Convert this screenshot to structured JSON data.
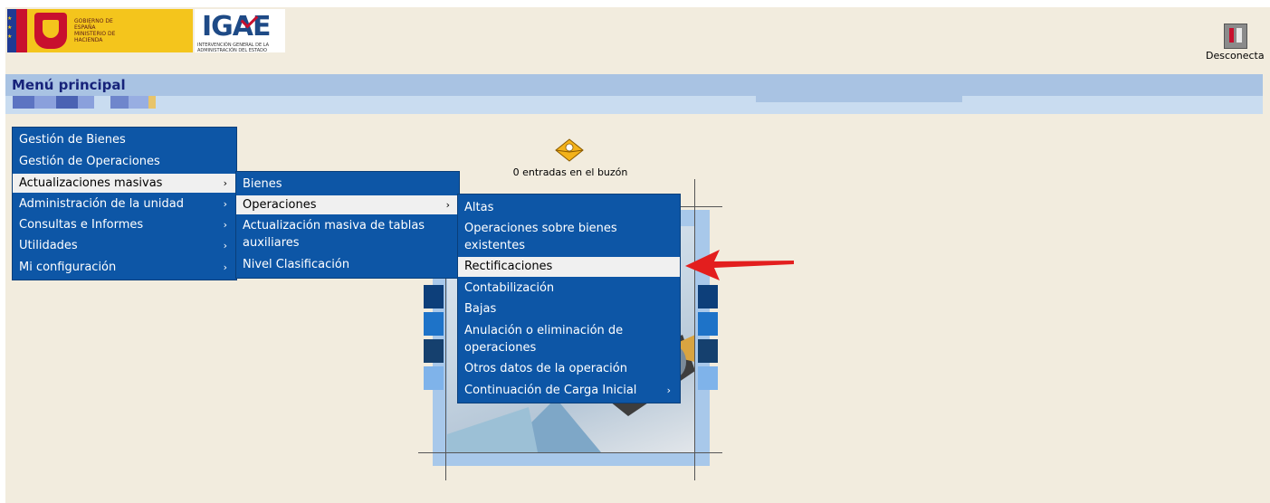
{
  "header": {
    "gov_text": "GOBIERNO DE ESPAÑA   MINISTERIO DE HACIENDA",
    "igae_title": "IGAE",
    "igae_subtitle": "INTERVENCIÓN GENERAL DE LA ADMINISTRACIÓN DEL ESTADO",
    "disconnect_label": "Desconecta"
  },
  "menubar": {
    "title": "Menú principal"
  },
  "mailbox": {
    "label": "0 entradas en el buzón"
  },
  "main_menu": {
    "items": [
      {
        "label": "Gestión de Bienes",
        "arrow": ""
      },
      {
        "label": "Gestión de Operaciones",
        "arrow": ""
      },
      {
        "label": "Actualizaciones masivas",
        "arrow": "›"
      },
      {
        "label": "Administración de la unidad",
        "arrow": "›"
      },
      {
        "label": "Consultas e Informes",
        "arrow": "›"
      },
      {
        "label": "Utilidades",
        "arrow": "›"
      },
      {
        "label": "Mi configuración",
        "arrow": "›"
      }
    ]
  },
  "sub_menu": {
    "items": [
      {
        "label": "Bienes",
        "arrow": ""
      },
      {
        "label": "Operaciones",
        "arrow": "›"
      },
      {
        "label": "Actualización masiva de tablas",
        "label2": "auxiliares",
        "arrow": ""
      },
      {
        "label": "Nivel Clasificación",
        "arrow": ""
      }
    ]
  },
  "sub_sub_menu": {
    "items": [
      {
        "label": "Altas",
        "arrow": ""
      },
      {
        "label": "Operaciones sobre bienes",
        "label2": "existentes",
        "arrow": ""
      },
      {
        "label": "Rectificaciones",
        "arrow": ""
      },
      {
        "label": "Contabilización",
        "arrow": ""
      },
      {
        "label": "Bajas",
        "arrow": ""
      },
      {
        "label": "Anulación o eliminación de",
        "label2": "operaciones",
        "arrow": ""
      },
      {
        "label": "Otros datos de la operación",
        "arrow": ""
      },
      {
        "label": "Continuación de Carga Inicial",
        "arrow": "›"
      }
    ]
  },
  "colors": {
    "menu_bg": "#0d56a6",
    "highlight_bg": "#f0f0f0",
    "page_bg": "#f2ecde",
    "menubar_bg": "#a9c3e3",
    "arrow_red": "#e31e1e"
  }
}
